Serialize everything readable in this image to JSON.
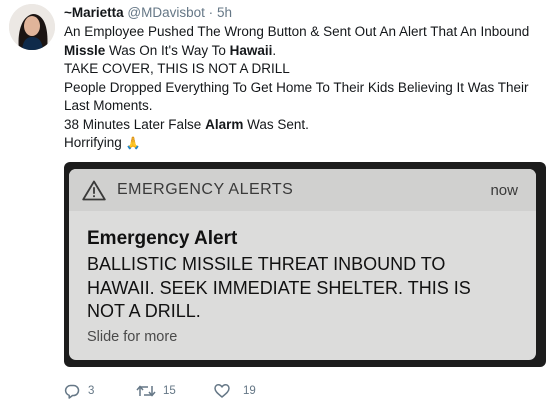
{
  "tweet": {
    "display_name": "~Marietta",
    "handle": "@MDavisbot",
    "separator": "·",
    "time": "5h",
    "lines": {
      "l1_a": "An Employee Pushed The Wrong Button & Sent Out An Alert That An Inbound",
      "l2_bold": "Missle",
      "l2_mid": " Was On It's Way To ",
      "l2_bold2": "Hawaii",
      "l2_end": ".",
      "l3": "TAKE COVER, THIS IS NOT A DRILL",
      "l4": "People Dropped Everything To Get Home To Their Kids Believing It Was Their Last Moments.",
      "l5_a": "38 Minutes Later False ",
      "l5_bold": "Alarm",
      "l5_end": " Was Sent.",
      "l6": "Horrifying",
      "l6_emoji": "🙏"
    }
  },
  "media": {
    "app_name": "EMERGENCY ALERTS",
    "time": "now",
    "title": "Emergency Alert",
    "message": "BALLISTIC MISSILE THREAT INBOUND TO HAWAII. SEEK IMMEDIATE SHELTER. THIS IS NOT A DRILL.",
    "hint": "Slide for more"
  },
  "actions": {
    "replies": "3",
    "retweets": "15",
    "likes": "19"
  },
  "colors": {
    "accent_gray": "#657786",
    "text": "#14171a",
    "card_bg": "#dcdcdb"
  }
}
